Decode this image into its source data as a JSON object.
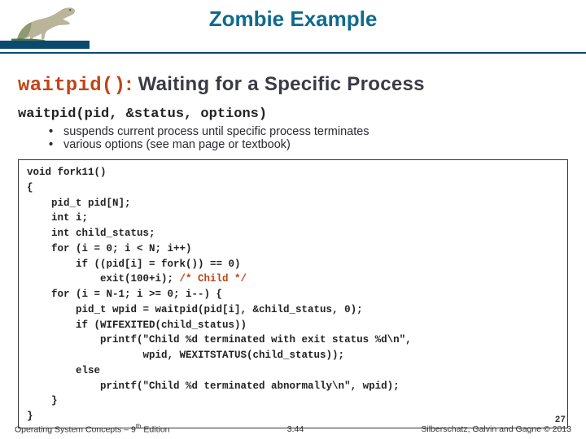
{
  "header": {
    "title": "Zombie Example"
  },
  "section": {
    "fn_name": "waitpid()",
    "fn_sep": ":",
    "heading_rest": " Waiting for a Specific Process",
    "signature": "waitpid(pid, &status, options)",
    "bullets": [
      "suspends current process until specific process terminates",
      "various options (see man page or textbook)"
    ]
  },
  "code": {
    "lines": [
      "void fork11()",
      "{",
      "    pid_t pid[N];",
      "    int i;",
      "    int child_status;",
      "    for (i = 0; i < N; i++)",
      "        if ((pid[i] = fork()) == 0)",
      "            exit(100+i); ",
      "    for (i = N-1; i >= 0; i--) {",
      "        pid_t wpid = waitpid(pid[i], &child_status, 0);",
      "        if (WIFEXITED(child_status))",
      "            printf(\"Child %d terminated with exit status %d\\n\",",
      "                   wpid, WEXITSTATUS(child_status));",
      "        else",
      "            printf(\"Child %d terminated abnormally\\n\", wpid);",
      "    }",
      "}"
    ],
    "comment": "/* Child */",
    "inner_page": "27"
  },
  "footer": {
    "left_a": "Operating System Concepts – 9",
    "left_sup": "th",
    "left_b": " Edition",
    "center": "3.44",
    "right": "Silberschatz, Galvin and Gagne © 2013"
  }
}
